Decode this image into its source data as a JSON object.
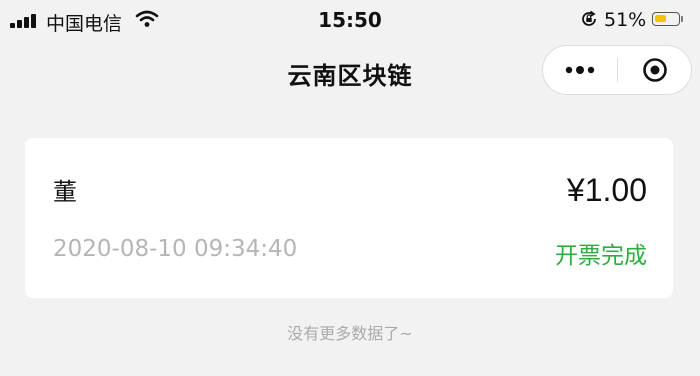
{
  "status_bar": {
    "carrier": "中国电信",
    "time": "15:50",
    "battery_percent": "51%",
    "battery_level": 0.51,
    "battery_color": "#f5c400",
    "icons": [
      "signal-icon",
      "wifi-icon",
      "rotation-lock-icon",
      "battery-icon"
    ]
  },
  "nav": {
    "title": "云南区块链",
    "capsule_icons": [
      "more-icon",
      "close-target-icon"
    ]
  },
  "records": [
    {
      "name": "董",
      "amount": "¥1.00",
      "datetime": "2020-08-10 09:34:40",
      "status": "开票完成",
      "status_color": "#2fae3f"
    }
  ],
  "footer": {
    "no_more_text": "没有更多数据了~"
  }
}
